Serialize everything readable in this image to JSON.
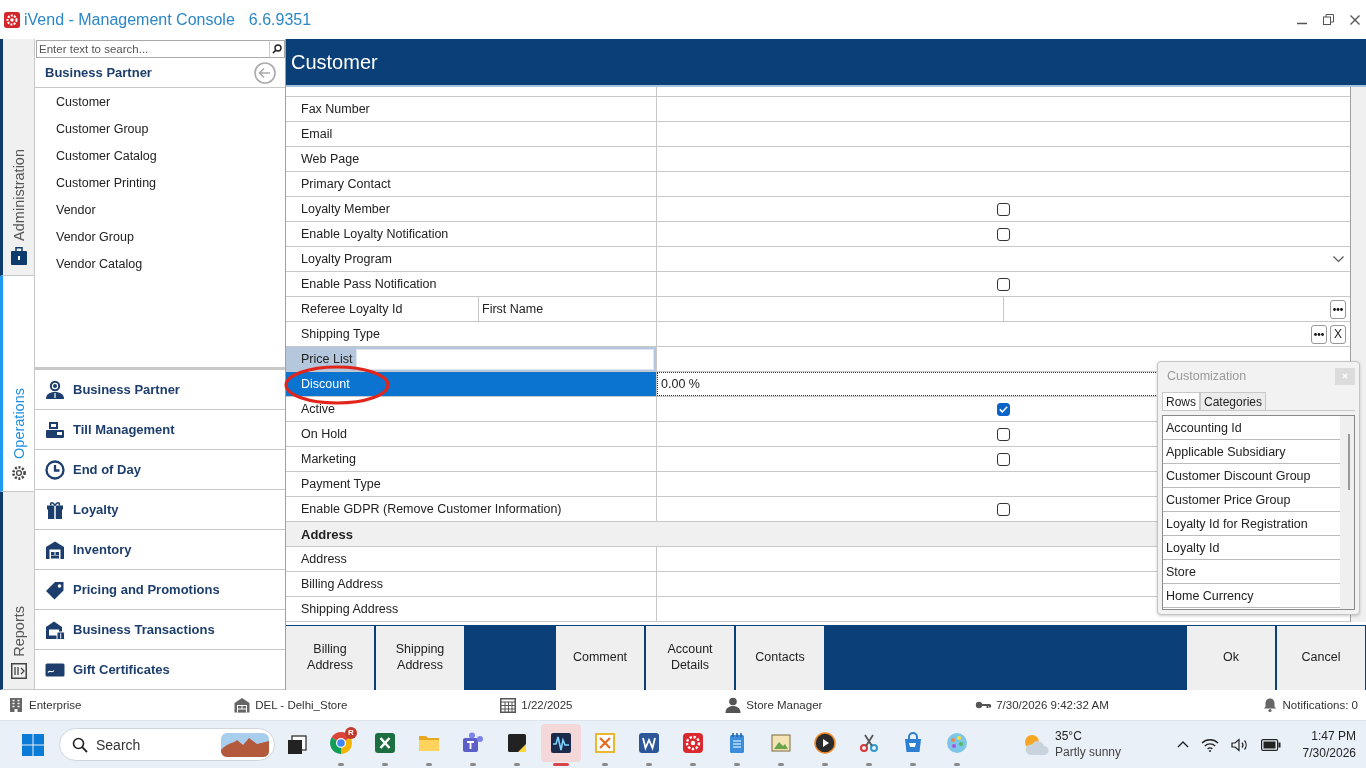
{
  "window": {
    "title": "iVend - Management Console",
    "version": "6.6.9351"
  },
  "side_tabs": [
    {
      "label": "Administration",
      "selected": false
    },
    {
      "label": "Operations",
      "selected": true
    },
    {
      "label": "Reports",
      "selected": false
    }
  ],
  "sidebar": {
    "search": {
      "placeholder": "Enter text to search..."
    },
    "title": "Business Partner",
    "items": [
      {
        "label": "Customer",
        "selected": false
      },
      {
        "label": "Customer Group",
        "selected": false
      },
      {
        "label": "Customer Catalog",
        "selected": false
      },
      {
        "label": "Customer Printing",
        "selected": false
      },
      {
        "label": "Vendor",
        "selected": false
      },
      {
        "label": "Vendor Group",
        "selected": false
      },
      {
        "label": "Vendor Catalog",
        "selected": false
      }
    ],
    "sections": [
      "Business Partner",
      "Till Management",
      "End of Day",
      "Loyalty",
      "Inventory",
      "Pricing and Promotions",
      "Business Transactions",
      "Gift Certificates"
    ]
  },
  "form": {
    "title": "Customer",
    "rows": [
      {
        "kind": "text",
        "label": "Fax Number",
        "selected": false,
        "editing": false
      },
      {
        "kind": "text",
        "label": "Email",
        "selected": false,
        "editing": false
      },
      {
        "kind": "text",
        "label": "Web Page",
        "selected": false,
        "editing": false
      },
      {
        "kind": "text",
        "label": "Primary Contact",
        "selected": false,
        "editing": false
      },
      {
        "kind": "checkbox",
        "label": "Loyalty Member",
        "checked": false,
        "selected": false,
        "editing": false
      },
      {
        "kind": "checkbox",
        "label": "Enable Loyalty Notification",
        "checked": false,
        "selected": false,
        "editing": false
      },
      {
        "kind": "dropdown",
        "label": "Loyalty Program",
        "selected": false,
        "editing": false
      },
      {
        "kind": "checkbox",
        "label": "Enable Pass Notification",
        "checked": false,
        "selected": false,
        "editing": false
      },
      {
        "kind": "lookup",
        "label": "Referee Loyalty Id",
        "sublabel": "First Name",
        "selected": false,
        "editing": false
      },
      {
        "kind": "lookup",
        "label": "Shipping Type",
        "clear_label": "X",
        "selected": false,
        "editing": false
      },
      {
        "kind": "text",
        "label": "Price List",
        "selected": false,
        "editing": true
      },
      {
        "kind": "text",
        "label": "Discount",
        "value": "0.00 %",
        "selected": true,
        "editing": false
      },
      {
        "kind": "checkbox",
        "label": "Active",
        "checked": true,
        "selected": false,
        "editing": false
      },
      {
        "kind": "checkbox",
        "label": "On Hold",
        "checked": false,
        "selected": false,
        "editing": false
      },
      {
        "kind": "checkbox",
        "label": "Marketing",
        "checked": false,
        "selected": false,
        "editing": false
      },
      {
        "kind": "text",
        "label": "Payment Type",
        "selected": false,
        "editing": false
      },
      {
        "kind": "checkbox",
        "label": "Enable GDPR (Remove Customer Information)",
        "checked": false,
        "selected": false,
        "editing": false
      },
      {
        "kind": "section",
        "label": "Address",
        "selected": false,
        "editing": false
      },
      {
        "kind": "text",
        "label": "Address",
        "selected": false,
        "editing": false
      },
      {
        "kind": "text",
        "label": "Billing Address",
        "selected": false,
        "editing": false
      },
      {
        "kind": "text",
        "label": "Shipping Address",
        "selected": false,
        "editing": false
      }
    ]
  },
  "customization": {
    "title": "Customization",
    "tabs": [
      {
        "label": "Rows",
        "selected": true
      },
      {
        "label": "Categories",
        "selected": false
      }
    ],
    "items": [
      "Accounting Id",
      "Applicable Subsidiary",
      "Customer Discount Group",
      "Customer Price Group",
      "Loyalty Id for Registration",
      "Loyalty Id",
      "Store",
      "Home Currency"
    ]
  },
  "button_groups": [
    [
      "Billing Address",
      "Shipping Address"
    ],
    [
      "Comment",
      "Account Details",
      "Contacts"
    ],
    [
      "Ok",
      "Cancel"
    ]
  ],
  "status_bar": [
    "Enterprise",
    "DEL - Delhi_Store",
    "1/22/2025",
    "Store Manager",
    "7/30/2026 9:42:32 AM",
    "Notifications: 0"
  ],
  "taskbar": {
    "search": {
      "placeholder": "Search"
    },
    "apps": [
      {
        "running": true,
        "active": false,
        "badge": "R"
      },
      {
        "running": true,
        "active": false
      },
      {
        "running": true,
        "active": false
      },
      {
        "running": true,
        "active": false
      },
      {
        "running": true,
        "active": false
      },
      {
        "running": true,
        "active": true
      },
      {
        "running": true,
        "active": false
      },
      {
        "running": true,
        "active": false
      },
      {
        "running": true,
        "active": false
      },
      {
        "running": true,
        "active": false
      },
      {
        "running": true,
        "active": false
      },
      {
        "running": true,
        "active": false
      },
      {
        "running": true,
        "active": false
      },
      {
        "running": true,
        "active": false
      },
      {
        "running": true,
        "active": false
      }
    ],
    "weather": {
      "temperature": "35°C",
      "condition": "Partly sunny"
    },
    "clock": {
      "time": "1:47 PM",
      "date": "7/30/2026"
    }
  }
}
